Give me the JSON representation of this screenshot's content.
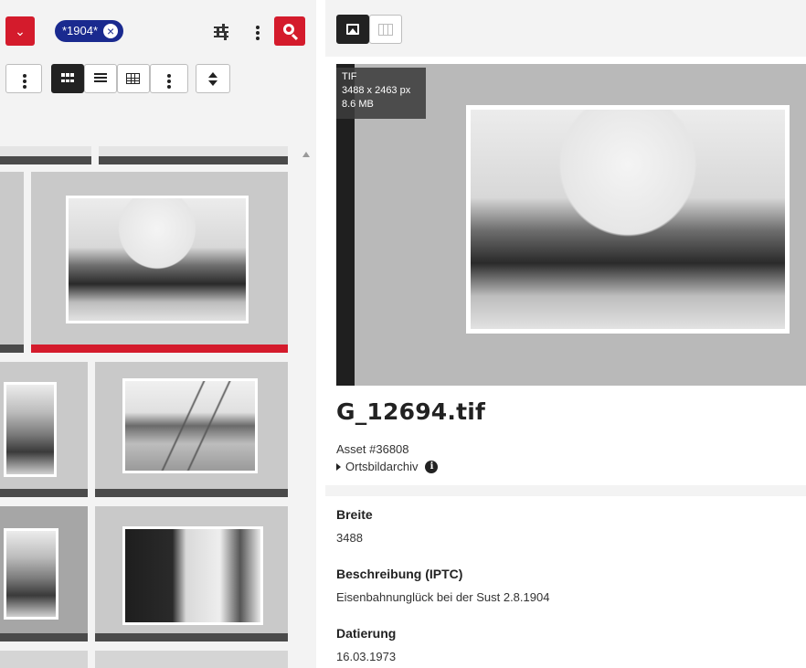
{
  "search": {
    "chip_label": "*1904*",
    "chip_close": "×"
  },
  "icons": {
    "dropdown": "chevron-down-icon",
    "filter": "tune-icon",
    "more": "kebab-icon",
    "search": "search-icon",
    "grid": "grid-view-icon",
    "list": "list-view-icon",
    "table": "table-view-icon",
    "sort": "sort-icon",
    "image": "image-icon",
    "map": "map-icon",
    "info": "info-icon"
  },
  "colors": {
    "accent": "#d41b2c",
    "chip": "#1a2a8f",
    "dark": "#222222"
  },
  "detail": {
    "file_type": "TIF",
    "dimensions": "3488 x 2463 px",
    "file_size": "8.6 MB",
    "title": "G_12694.tif",
    "asset_id": "Asset #36808",
    "archive": "Ortsbildarchiv",
    "info_glyph": "i",
    "fields": [
      {
        "label": "Breite",
        "value": "3488"
      },
      {
        "label": "Beschreibung (IPTC)",
        "value": "Eisenbahnunglück bei der Sust 2.8.1904"
      },
      {
        "label": "Datierung",
        "value": "16.03.1973"
      }
    ]
  }
}
